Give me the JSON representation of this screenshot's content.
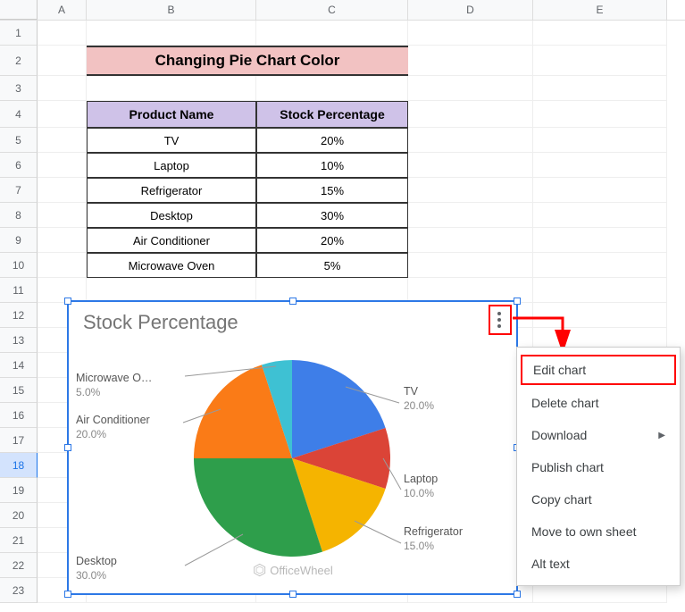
{
  "columns": [
    "A",
    "B",
    "C",
    "D",
    "E"
  ],
  "rows": [
    1,
    2,
    3,
    4,
    5,
    6,
    7,
    8,
    9,
    10,
    11,
    12,
    13,
    14,
    15,
    16,
    17,
    18,
    19,
    20,
    21,
    22,
    23
  ],
  "selected_row": 18,
  "title": "Changing Pie Chart Color",
  "table": {
    "headers": [
      "Product Name",
      "Stock Percentage"
    ],
    "rows": [
      [
        "TV",
        "20%"
      ],
      [
        "Laptop",
        "10%"
      ],
      [
        "Refrigerator",
        "15%"
      ],
      [
        "Desktop",
        "30%"
      ],
      [
        "Air Conditioner",
        "20%"
      ],
      [
        "Microwave Oven",
        "5%"
      ]
    ]
  },
  "chart": {
    "title": "Stock Percentage",
    "labels": {
      "tv": "TV",
      "tv_pct": "20.0%",
      "laptop": "Laptop",
      "laptop_pct": "10.0%",
      "refrigerator": "Refrigerator",
      "refrigerator_pct": "15.0%",
      "desktop": "Desktop",
      "desktop_pct": "30.0%",
      "ac": "Air Conditioner",
      "ac_pct": "20.0%",
      "microwave": "Microwave O…",
      "microwave_pct": "5.0%"
    }
  },
  "menu": {
    "edit": "Edit chart",
    "delete": "Delete chart",
    "download": "Download",
    "publish": "Publish chart",
    "copy": "Copy chart",
    "move": "Move to own sheet",
    "alt": "Alt text"
  },
  "watermark": "OfficeWheel",
  "chart_data": {
    "type": "pie",
    "title": "Stock Percentage",
    "categories": [
      "TV",
      "Laptop",
      "Refrigerator",
      "Desktop",
      "Air Conditioner",
      "Microwave Oven"
    ],
    "values": [
      20,
      10,
      15,
      30,
      20,
      5
    ],
    "colors": [
      "#3e7ee8",
      "#db4437",
      "#f5b400",
      "#2e9e4b",
      "#fa7b17",
      "#3ec1d3"
    ],
    "legend_labels": [
      "TV 20.0%",
      "Laptop 10.0%",
      "Refrigerator 15.0%",
      "Desktop 30.0%",
      "Air Conditioner 20.0%",
      "Microwave Oven 5.0%"
    ]
  }
}
